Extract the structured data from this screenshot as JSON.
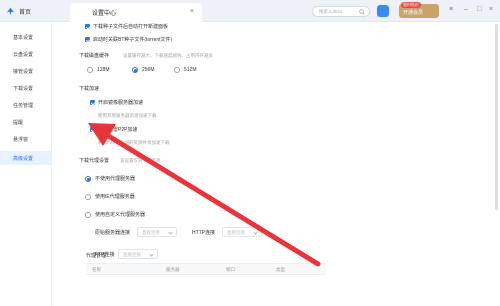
{
  "titlebar": {
    "home_tab": "首页",
    "settings_tab": "设置中心",
    "search_placeholder": "搜索入2022",
    "vip_badge": "限时低价",
    "vip_label": "开通会员"
  },
  "sidebar": {
    "items": [
      {
        "label": "基本设置"
      },
      {
        "label": "云盘设置"
      },
      {
        "label": "接管设置"
      },
      {
        "label": "下载设置"
      },
      {
        "label": "任务管理"
      },
      {
        "label": "提醒"
      },
      {
        "label": "悬浮窗"
      },
      {
        "label": "高级设置"
      }
    ],
    "active_index": 7
  },
  "main": {
    "top_options": [
      {
        "label": "下载种子文件后自动打开新建面板",
        "checked": true
      },
      {
        "label": "启动时关联BT种子文件(torrent文件)",
        "checked": true
      }
    ],
    "cache": {
      "title": "下载磁盘缓存",
      "hint": "设置缓存越大，下载速度越快，占用内存越多",
      "options": [
        "128M",
        "256M",
        "512M"
      ],
      "selected": "256M"
    },
    "accel": {
      "title": "下载加速",
      "mirror_label": "开启镜像服务器加速",
      "mirror_checked": true,
      "mirror_hint": "使用其他服务器资源加速下载",
      "p2p_label": "开启迅雷P2P加速",
      "p2p_checked": true,
      "p2p_hint": "利用P2P用户间的资源共享加速下载"
    },
    "proxy": {
      "title": "下载代理设置",
      "hint": "该设置仅对下载有效",
      "options": [
        "不使用代理服务器",
        "使用IE代理服务器",
        "使用自定义代理服务器"
      ],
      "selected": 0,
      "origin_label": "原始服务器连接",
      "http_label": "HTTP连接",
      "ftp_label": "FTP连接",
      "select_placeholder": "直接连接",
      "manage_title": "代理管理",
      "columns": [
        "名称",
        "服务器",
        "端口",
        "类型"
      ]
    }
  },
  "colors": {
    "accent": "#2b73e8",
    "arrow": "#e8343a",
    "sidebar_active_bg": "#e8f1ff"
  }
}
